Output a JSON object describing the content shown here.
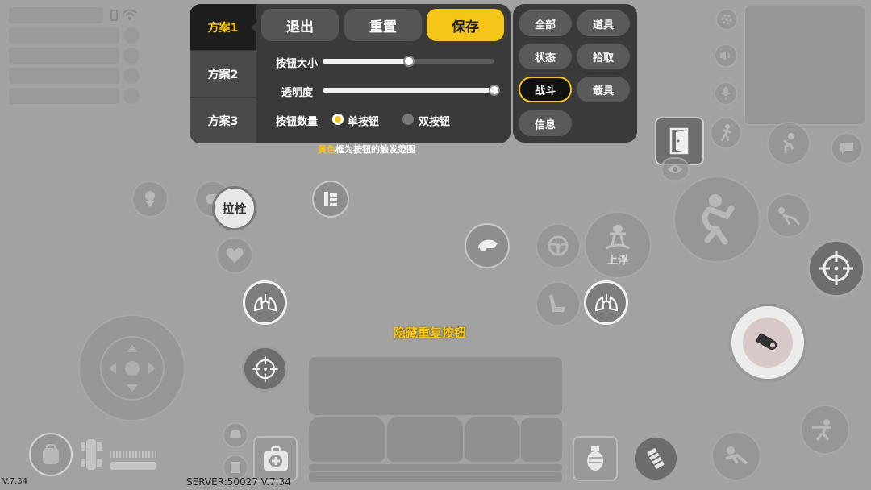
{
  "settings": {
    "schemes": [
      "方案1",
      "方案2",
      "方案3"
    ],
    "active_scheme": 0,
    "exit_label": "退出",
    "reset_label": "重置",
    "save_label": "保存",
    "size_label": "按钮大小",
    "size_value": 0.5,
    "opacity_label": "透明度",
    "opacity_value": 1.0,
    "count_label": "按钮数量",
    "single_label": "单按钮",
    "double_label": "双按钮",
    "selected_count": "single"
  },
  "categories": {
    "items": [
      "全部",
      "道具",
      "状态",
      "拾取",
      "战斗",
      "载具",
      "信息"
    ],
    "active": "战斗"
  },
  "hint": {
    "highlight": "黄色",
    "rest": "框为按钮的触发范围"
  },
  "controls": {
    "bolt_label": "拉栓",
    "float_label": "上浮",
    "hide_duplicate_label": "隐藏重复按钮"
  },
  "footer": {
    "version_left": "V.7.34",
    "server": "SERVER:50027 V.7.34"
  },
  "colors": {
    "accent": "#f5c518",
    "panel": "#3a3a3a",
    "background": "#a2a2a2"
  }
}
